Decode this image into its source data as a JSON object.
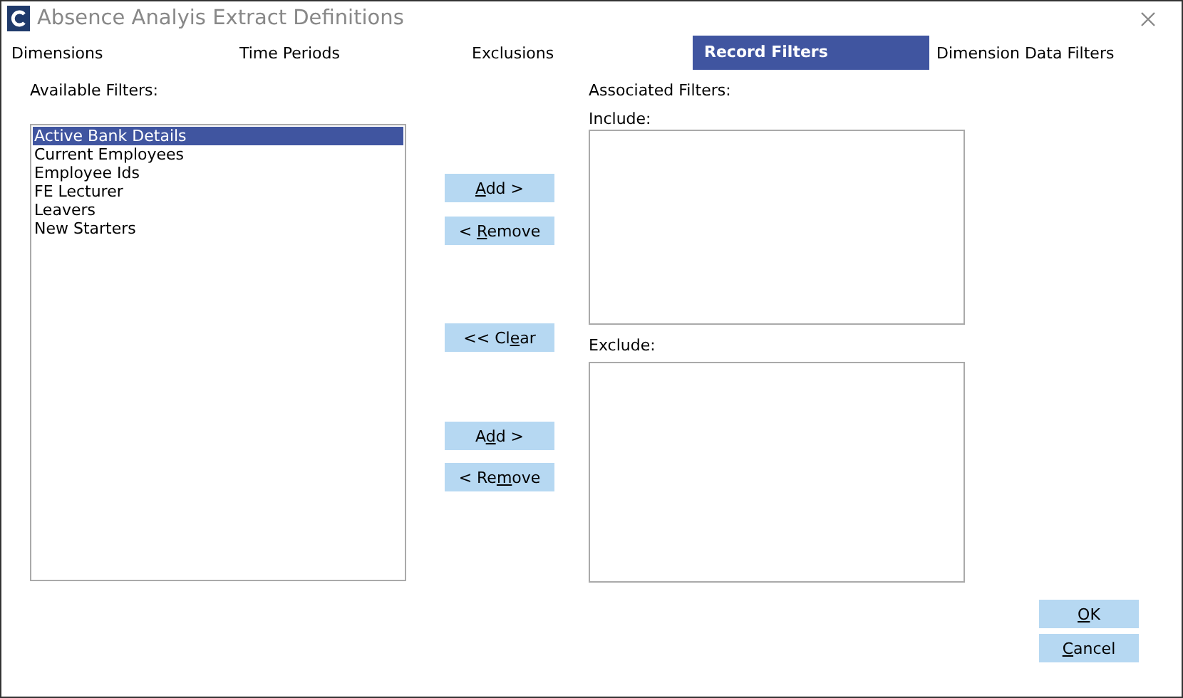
{
  "window": {
    "title": "Absence Analyis Extract Definitions"
  },
  "tabs": [
    {
      "label": "Dimensions",
      "selected": false
    },
    {
      "label": "Time Periods",
      "selected": false
    },
    {
      "label": "Exclusions",
      "selected": false
    },
    {
      "label": "Record Filters",
      "selected": true
    },
    {
      "label": "Dimension Data Filters",
      "selected": false
    }
  ],
  "available": {
    "label": "Available Filters:",
    "items": [
      {
        "label": "Active Bank Details",
        "selected": true
      },
      {
        "label": "Current Employees",
        "selected": false
      },
      {
        "label": "Employee Ids",
        "selected": false
      },
      {
        "label": "FE Lecturer",
        "selected": false
      },
      {
        "label": "Leavers",
        "selected": false
      },
      {
        "label": "New Starters",
        "selected": false
      }
    ]
  },
  "include_buttons": [
    {
      "key": "A",
      "post": "dd >"
    },
    {
      "pre": "< ",
      "key": "R",
      "post": "emove"
    }
  ],
  "clear_button": {
    "pre": "<< Cl",
    "key": "e",
    "post": "ar"
  },
  "exclude_buttons": [
    {
      "pre": "A",
      "key": "d",
      "post": "d >"
    },
    {
      "pre": "< Re",
      "key": "m",
      "post": "ove"
    }
  ],
  "associated": {
    "label": "Associated Filters:",
    "include_label": "Include:",
    "exclude_label": "Exclude:"
  },
  "footer_buttons": [
    {
      "key": "O",
      "post": "K"
    },
    {
      "key": "C",
      "post": "ancel"
    }
  ]
}
